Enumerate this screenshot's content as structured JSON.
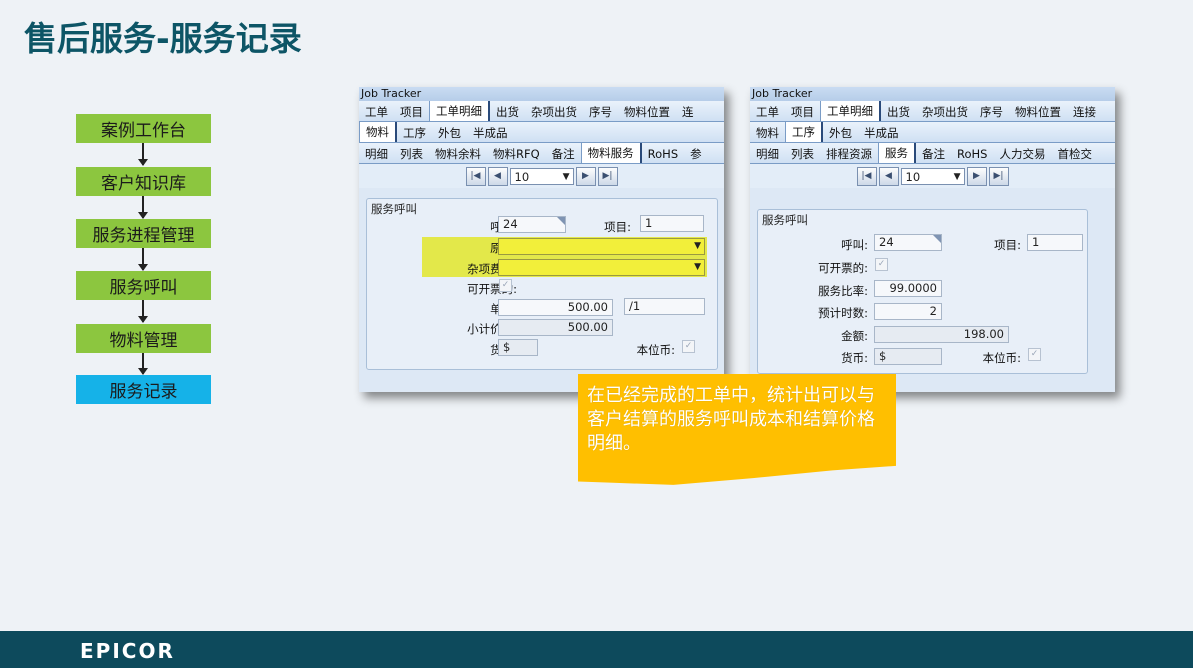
{
  "slide": {
    "title": "售后服务-服务记录"
  },
  "flow": [
    "案例工作台",
    "客户知识库",
    "服务进程管理",
    "服务呼叫",
    "物料管理",
    "服务记录"
  ],
  "left_window": {
    "title": "Job Tracker",
    "tabs1": [
      "工单",
      "项目",
      "工单明细",
      "出货",
      "杂项出货",
      "序号",
      "物料位置",
      "连"
    ],
    "tabs2": [
      "物料",
      "工序",
      "外包",
      "半成品"
    ],
    "tabs3": [
      "明细",
      "列表",
      "物料余料",
      "物料RFQ",
      "备注",
      "物料服务",
      "RoHS",
      "参"
    ],
    "nav_value": "10",
    "group_title": "服务呼叫",
    "call_label": "呼叫:",
    "call_value": "24",
    "project_label": "项目:",
    "project_value": "1",
    "reason_label": "原因:",
    "misc_label": "杂项费用:",
    "invoiceable_label": "可开票的:",
    "unit_price_label": "单价:",
    "unit_price_value": "500.00",
    "unit_value": "/1",
    "subtotal_label": "小计价格:",
    "subtotal_value": "500.00",
    "currency_label": "货币:",
    "currency_value": "$",
    "base_currency_label": "本位币:"
  },
  "right_window": {
    "title": "Job Tracker",
    "tabs1": [
      "工单",
      "项目",
      "工单明细",
      "出货",
      "杂项出货",
      "序号",
      "物料位置",
      "连接"
    ],
    "tabs2": [
      "物料",
      "工序",
      "外包",
      "半成品"
    ],
    "tabs3": [
      "明细",
      "列表",
      "排程资源",
      "服务",
      "备注",
      "RoHS",
      "人力交易",
      "首检交"
    ],
    "nav_value": "10",
    "group_title": "服务呼叫",
    "call_label": "呼叫:",
    "call_value": "24",
    "project_label": "项目:",
    "project_value": "1",
    "invoiceable_label": "可开票的:",
    "rate_label": "服务比率:",
    "rate_value": "99.0000",
    "hours_label": "预计时数:",
    "hours_value": "2",
    "amount_label": "金额:",
    "amount_value": "198.00",
    "currency_label": "货币:",
    "currency_value": "$",
    "base_currency_label": "本位币:"
  },
  "callout": {
    "text": "在已经完成的工单中，统计出可以与客户结算的服务呼叫成本和结算价格明细。"
  },
  "footer": {
    "logo": "EPICOR"
  },
  "icons": {
    "nav": [
      "first-record-icon",
      "prev-record-icon",
      "next-record-icon",
      "last-record-icon"
    ],
    "check": "checkmark-icon"
  },
  "colors": {
    "title": "#0d5566",
    "flow_box": "#8cc63f",
    "flow_active": "#15b2e8",
    "callout": "#ffbf00",
    "highlight": "#e3e84a",
    "footer": "#0d4a5c"
  }
}
